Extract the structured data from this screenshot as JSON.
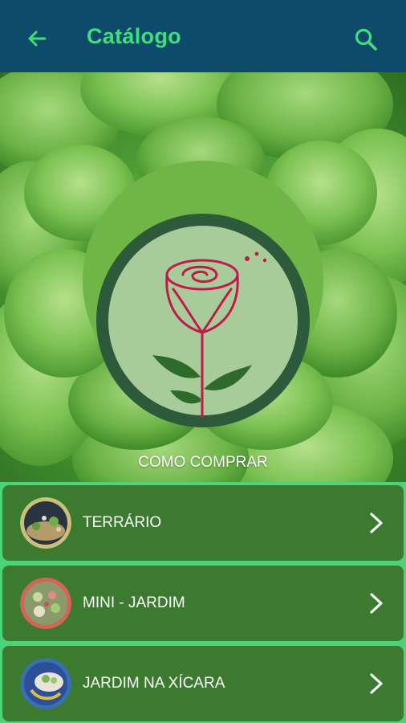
{
  "appbar": {
    "title": "Catálogo",
    "back_icon": "arrow-left-icon",
    "search_icon": "search-icon",
    "background": "#0e4a6a",
    "accent": "#3ee07a"
  },
  "hero": {
    "link_label": "COMO COMPRAR",
    "emblem_icon": "rose-logo-icon"
  },
  "catalog": {
    "items": [
      {
        "label": "TERRÁRIO",
        "thumb_icon": "terrarium-thumbnail"
      },
      {
        "label": "MINI - JARDIM",
        "thumb_icon": "mini-garden-thumbnail"
      },
      {
        "label": "JARDIM NA XÍCARA",
        "thumb_icon": "teacup-garden-thumbnail"
      }
    ],
    "card_color": "#3c7a30",
    "chevron_icon": "chevron-right-icon"
  }
}
